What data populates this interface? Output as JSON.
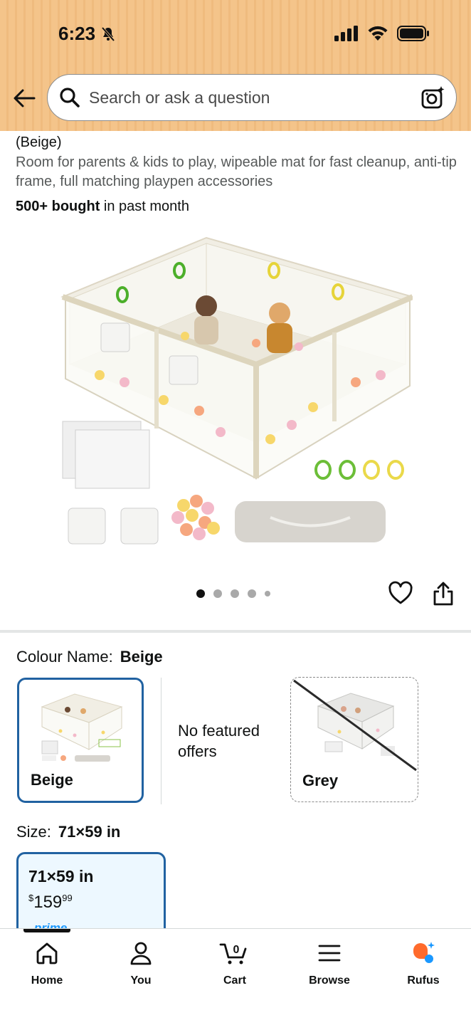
{
  "status_bar": {
    "time": "6:23"
  },
  "search": {
    "placeholder": "Search or ask a question"
  },
  "product": {
    "color_paren": "(Beige)",
    "description": "Room for parents & kids to play, wipeable mat for fast cleanup, anti-tip frame, full matching playpen accessories",
    "bought_bold": "500+ bought",
    "bought_rest": " in past month",
    "image_dots": {
      "count": 5,
      "active_index": 0
    }
  },
  "colour": {
    "label": "Colour Name:",
    "selected": "Beige",
    "options": [
      {
        "name": "Beige",
        "selected": true,
        "available": true
      },
      {
        "name": "Grey",
        "selected": false,
        "available": false
      }
    ],
    "no_offers_text": "No featured offers"
  },
  "size": {
    "label": "Size:",
    "selected": "71×59 in",
    "options": [
      {
        "name": "71×59 in",
        "price_symbol": "$",
        "price_whole": "159",
        "price_fraction": "99",
        "badge": "prime"
      }
    ]
  },
  "bottom_nav": {
    "items": [
      {
        "label": "Home",
        "icon": "home-icon",
        "active": true
      },
      {
        "label": "You",
        "icon": "person-icon"
      },
      {
        "label": "Cart",
        "icon": "cart-icon",
        "badge": "0"
      },
      {
        "label": "Browse",
        "icon": "menu-icon"
      },
      {
        "label": "Rufus",
        "icon": "rufus-icon"
      }
    ]
  },
  "colors": {
    "header_bg": "#f4c48a",
    "selected_border": "#2162a1",
    "size_card_bg": "#edf8ff",
    "rufus_orange": "#ff6b2c",
    "rufus_blue": "#1a98ff"
  }
}
